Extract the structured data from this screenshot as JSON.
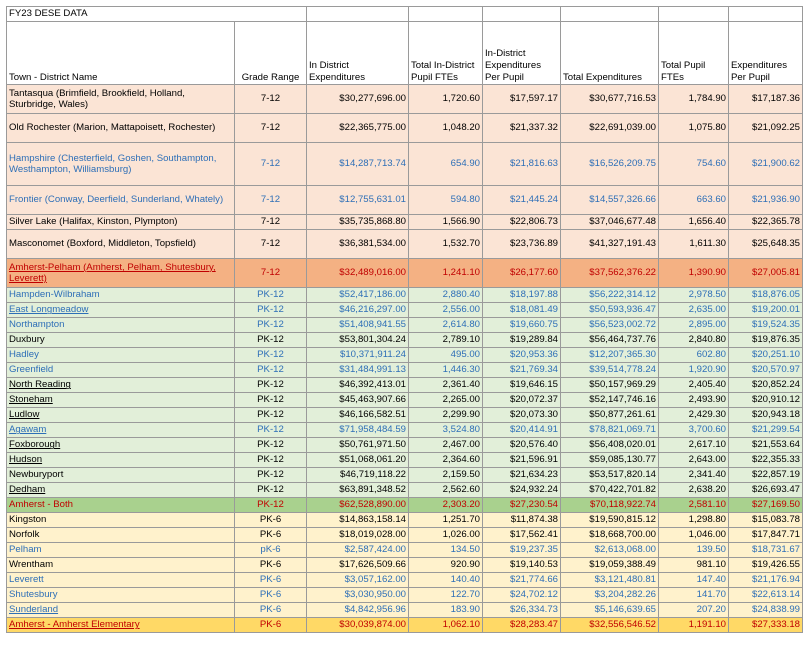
{
  "title": "FY23 DESE DATA",
  "headers": [
    "Town - District Name",
    "Grade Range",
    "In District Expenditures",
    "Total In-District Pupil FTEs",
    "In-District Expenditures Per Pupil",
    "Total Expenditures",
    "Total Pupil FTEs",
    "Expenditures Per Pupil"
  ],
  "colors": {
    "peach": "#fbe4d5",
    "salmon": "#f4b183",
    "green": "#e2efd9",
    "olive": "#a9d18e",
    "yellow": "#fff2cc",
    "gold": "#ffd966",
    "blue_text": "#2e6fb7",
    "red_text": "#c00000"
  },
  "rows": [
    {
      "name": "Tantasqua (Brimfield, Brookfield, Holland, Sturbridge, Wales)",
      "grade": "7-12",
      "in_exp": "$30,277,696.00",
      "in_fte": "1,720.60",
      "in_pp": "$17,597.17",
      "tot_exp": "$30,677,716.53",
      "tot_fte": "1,784.90",
      "pp": "$17,187.36",
      "bg": "peach",
      "text": "black",
      "ul": false,
      "h": 2
    },
    {
      "name": "Old Rochester (Marion, Mattapoisett, Rochester)",
      "grade": "7-12",
      "in_exp": "$22,365,775.00",
      "in_fte": "1,048.20",
      "in_pp": "$21,337.32",
      "tot_exp": "$22,691,039.00",
      "tot_fte": "1,075.80",
      "pp": "$21,092.25",
      "bg": "peach",
      "text": "black",
      "ul": false,
      "h": 2
    },
    {
      "name": "Hampshire (Chesterfield, Goshen, Southampton, Westhampton, Williamsburg)",
      "grade": "7-12",
      "in_exp": "$14,287,713.74",
      "in_fte": "654.90",
      "in_pp": "$21,816.63",
      "tot_exp": "$16,526,209.75",
      "tot_fte": "754.60",
      "pp": "$21,900.62",
      "bg": "peach",
      "text": "blue",
      "ul": false,
      "h": 3
    },
    {
      "name": "Frontier (Conway, Deerfield, Sunderland, Whately)",
      "grade": "7-12",
      "in_exp": "$12,755,631.01",
      "in_fte": "594.80",
      "in_pp": "$21,445.24",
      "tot_exp": "$14,557,326.66",
      "tot_fte": "663.60",
      "pp": "$21,936.90",
      "bg": "peach",
      "text": "blue",
      "ul": false,
      "h": 2
    },
    {
      "name": "Silver Lake (Halifax, Kinston, Plympton)",
      "grade": "7-12",
      "in_exp": "$35,735,868.80",
      "in_fte": "1,566.90",
      "in_pp": "$22,806.73",
      "tot_exp": "$37,046,677.48",
      "tot_fte": "1,656.40",
      "pp": "$22,365.78",
      "bg": "peach",
      "text": "black",
      "ul": false,
      "h": 1
    },
    {
      "name": "Masconomet (Boxford, Middleton, Topsfield)",
      "grade": "7-12",
      "in_exp": "$36,381,534.00",
      "in_fte": "1,532.70",
      "in_pp": "$23,736.89",
      "tot_exp": "$41,327,191.43",
      "tot_fte": "1,611.30",
      "pp": "$25,648.35",
      "bg": "peach",
      "text": "black",
      "ul": false,
      "h": 2
    },
    {
      "name": "Amherst-Pelham (Amherst, Pelham, Shutesbury, Leverett)",
      "grade": "7-12",
      "in_exp": "$32,489,016.00",
      "in_fte": "1,241.10",
      "in_pp": "$26,177.60",
      "tot_exp": "$37,562,376.22",
      "tot_fte": "1,390.90",
      "pp": "$27,005.81",
      "bg": "salmon",
      "text": "red",
      "ul": true,
      "h": 2
    },
    {
      "name": "Hampden-Wilbraham",
      "grade": "PK-12",
      "in_exp": "$52,417,186.00",
      "in_fte": "2,880.40",
      "in_pp": "$18,197.88",
      "tot_exp": "$56,222,314.12",
      "tot_fte": "2,978.50",
      "pp": "$18,876.05",
      "bg": "green",
      "text": "blue",
      "ul": false,
      "h": 1
    },
    {
      "name": "East Longmeadow",
      "grade": "PK-12",
      "in_exp": "$46,216,297.00",
      "in_fte": "2,556.00",
      "in_pp": "$18,081.49",
      "tot_exp": "$50,593,936.47",
      "tot_fte": "2,635.00",
      "pp": "$19,200.01",
      "bg": "green",
      "text": "blue",
      "ul": true,
      "h": 1
    },
    {
      "name": "Northampton",
      "grade": "PK-12",
      "in_exp": "$51,408,941.55",
      "in_fte": "2,614.80",
      "in_pp": "$19,660.75",
      "tot_exp": "$56,523,002.72",
      "tot_fte": "2,895.00",
      "pp": "$19,524.35",
      "bg": "green",
      "text": "blue",
      "ul": false,
      "h": 1
    },
    {
      "name": "Duxbury",
      "grade": "PK-12",
      "in_exp": "$53,801,304.24",
      "in_fte": "2,789.10",
      "in_pp": "$19,289.84",
      "tot_exp": "$56,464,737.76",
      "tot_fte": "2,840.80",
      "pp": "$19,876.35",
      "bg": "green",
      "text": "black",
      "ul": false,
      "h": 1
    },
    {
      "name": "Hadley",
      "grade": "PK-12",
      "in_exp": "$10,371,911.24",
      "in_fte": "495.00",
      "in_pp": "$20,953.36",
      "tot_exp": "$12,207,365.30",
      "tot_fte": "602.80",
      "pp": "$20,251.10",
      "bg": "green",
      "text": "blue",
      "ul": false,
      "h": 1
    },
    {
      "name": "Greenfield",
      "grade": "PK-12",
      "in_exp": "$31,484,991.13",
      "in_fte": "1,446.30",
      "in_pp": "$21,769.34",
      "tot_exp": "$39,514,778.24",
      "tot_fte": "1,920.90",
      "pp": "$20,570.97",
      "bg": "green",
      "text": "blue",
      "ul": false,
      "h": 1
    },
    {
      "name": "North Reading",
      "grade": "PK-12",
      "in_exp": "$46,392,413.01",
      "in_fte": "2,361.40",
      "in_pp": "$19,646.15",
      "tot_exp": "$50,157,969.29",
      "tot_fte": "2,405.40",
      "pp": "$20,852.24",
      "bg": "green",
      "text": "black",
      "ul": true,
      "h": 1
    },
    {
      "name": "Stoneham",
      "grade": "PK-12",
      "in_exp": "$45,463,907.66",
      "in_fte": "2,265.00",
      "in_pp": "$20,072.37",
      "tot_exp": "$52,147,746.16",
      "tot_fte": "2,493.90",
      "pp": "$20,910.12",
      "bg": "green",
      "text": "black",
      "ul": true,
      "h": 1
    },
    {
      "name": "Ludlow",
      "grade": "PK-12",
      "in_exp": "$46,166,582.51",
      "in_fte": "2,299.90",
      "in_pp": "$20,073.30",
      "tot_exp": "$50,877,261.61",
      "tot_fte": "2,429.30",
      "pp": "$20,943.18",
      "bg": "green",
      "text": "black",
      "ul": true,
      "h": 1
    },
    {
      "name": "Agawam",
      "grade": "PK-12",
      "in_exp": "$71,958,484.59",
      "in_fte": "3,524.80",
      "in_pp": "$20,414.91",
      "tot_exp": "$78,821,069.71",
      "tot_fte": "3,700.60",
      "pp": "$21,299.54",
      "bg": "green",
      "text": "blue",
      "ul": true,
      "h": 1
    },
    {
      "name": "Foxborough",
      "grade": "PK-12",
      "in_exp": "$50,761,971.50",
      "in_fte": "2,467.00",
      "in_pp": "$20,576.40",
      "tot_exp": "$56,408,020.01",
      "tot_fte": "2,617.10",
      "pp": "$21,553.64",
      "bg": "green",
      "text": "black",
      "ul": true,
      "h": 1
    },
    {
      "name": "Hudson",
      "grade": "PK-12",
      "in_exp": "$51,068,061.20",
      "in_fte": "2,364.60",
      "in_pp": "$21,596.91",
      "tot_exp": "$59,085,130.77",
      "tot_fte": "2,643.00",
      "pp": "$22,355.33",
      "bg": "green",
      "text": "black",
      "ul": true,
      "h": 1
    },
    {
      "name": "Newburyport",
      "grade": "PK-12",
      "in_exp": "$46,719,118.22",
      "in_fte": "2,159.50",
      "in_pp": "$21,634.23",
      "tot_exp": "$53,517,820.14",
      "tot_fte": "2,341.40",
      "pp": "$22,857.19",
      "bg": "green",
      "text": "black",
      "ul": false,
      "h": 1
    },
    {
      "name": "Dedham",
      "grade": "PK-12",
      "in_exp": "$63,891,348.52",
      "in_fte": "2,562.60",
      "in_pp": "$24,932.24",
      "tot_exp": "$70,422,701.82",
      "tot_fte": "2,638.20",
      "pp": "$26,693.47",
      "bg": "green",
      "text": "black",
      "ul": true,
      "h": 1
    },
    {
      "name": "Amherst - Both",
      "grade": "PK-12",
      "in_exp": "$62,528,890.00",
      "in_fte": "2,303.20",
      "in_pp": "$27,230.54",
      "tot_exp": "$70,118,922.74",
      "tot_fte": "2,581.10",
      "pp": "$27,169.50",
      "bg": "olive",
      "text": "red",
      "ul": false,
      "h": 1
    },
    {
      "name": "Kingston",
      "grade": "PK-6",
      "in_exp": "$14,863,158.14",
      "in_fte": "1,251.70",
      "in_pp": "$11,874.38",
      "tot_exp": "$19,590,815.12",
      "tot_fte": "1,298.80",
      "pp": "$15,083.78",
      "bg": "yellow",
      "text": "black",
      "ul": false,
      "h": 1
    },
    {
      "name": "Norfolk",
      "grade": "PK-6",
      "in_exp": "$18,019,028.00",
      "in_fte": "1,026.00",
      "in_pp": "$17,562.41",
      "tot_exp": "$18,668,700.00",
      "tot_fte": "1,046.00",
      "pp": "$17,847.71",
      "bg": "yellow",
      "text": "black",
      "ul": false,
      "h": 1
    },
    {
      "name": "Pelham",
      "grade": "pK-6",
      "in_exp": "$2,587,424.00",
      "in_fte": "134.50",
      "in_pp": "$19,237.35",
      "tot_exp": "$2,613,068.00",
      "tot_fte": "139.50",
      "pp": "$18,731.67",
      "bg": "yellow",
      "text": "blue",
      "ul": false,
      "h": 1
    },
    {
      "name": "Wrentham",
      "grade": "PK-6",
      "in_exp": "$17,626,509.66",
      "in_fte": "920.90",
      "in_pp": "$19,140.53",
      "tot_exp": "$19,059,388.49",
      "tot_fte": "981.10",
      "pp": "$19,426.55",
      "bg": "yellow",
      "text": "black",
      "ul": false,
      "h": 1
    },
    {
      "name": "Leverett",
      "grade": "PK-6",
      "in_exp": "$3,057,162.00",
      "in_fte": "140.40",
      "in_pp": "$21,774.66",
      "tot_exp": "$3,121,480.81",
      "tot_fte": "147.40",
      "pp": "$21,176.94",
      "bg": "yellow",
      "text": "blue",
      "ul": false,
      "h": 1
    },
    {
      "name": "Shutesbury",
      "grade": "PK-6",
      "in_exp": "$3,030,950.00",
      "in_fte": "122.70",
      "in_pp": "$24,702.12",
      "tot_exp": "$3,204,282.26",
      "tot_fte": "141.70",
      "pp": "$22,613.14",
      "bg": "yellow",
      "text": "blue",
      "ul": false,
      "h": 1
    },
    {
      "name": "Sunderland",
      "grade": "PK-6",
      "in_exp": "$4,842,956.96",
      "in_fte": "183.90",
      "in_pp": "$26,334.73",
      "tot_exp": "$5,146,639.65",
      "tot_fte": "207.20",
      "pp": "$24,838.99",
      "bg": "yellow",
      "text": "blue",
      "ul": true,
      "h": 1
    },
    {
      "name": "Amherst - Amherst Elementary",
      "grade": "PK-6",
      "in_exp": "$30,039,874.00",
      "in_fte": "1,062.10",
      "in_pp": "$28,283.47",
      "tot_exp": "$32,556,546.52",
      "tot_fte": "1,191.10",
      "pp": "$27,333.18",
      "bg": "gold",
      "text": "red",
      "ul": true,
      "h": 1
    }
  ]
}
